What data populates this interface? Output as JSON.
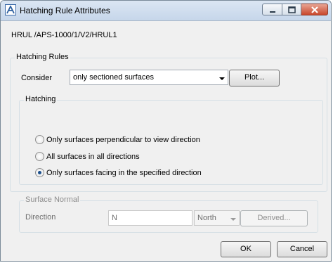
{
  "window": {
    "title": "Hatching Rule Attributes",
    "controls": {
      "minimize_icon": "minimize-icon",
      "maximize_icon": "maximize-icon",
      "close_icon": "close-icon"
    }
  },
  "path": "HRUL /APS-1000/1/V2/HRUL1",
  "hatching_rules": {
    "group_label": "Hatching Rules",
    "consider_label": "Consider",
    "consider_value": "only sectioned surfaces",
    "plot_label": "Plot..."
  },
  "hatching": {
    "group_label": "Hatching",
    "options": [
      {
        "label": "Only surfaces perpendicular to view direction",
        "checked": false
      },
      {
        "label": "All surfaces in all directions",
        "checked": false
      },
      {
        "label": "Only surfaces facing in the specified direction",
        "checked": true
      }
    ]
  },
  "surface_normal": {
    "group_label": "Surface Normal",
    "direction_label": "Direction",
    "direction_value": "N",
    "direction_choice": "North",
    "derived_label": "Derived..."
  },
  "footer": {
    "ok_label": "OK",
    "cancel_label": "Cancel"
  }
}
